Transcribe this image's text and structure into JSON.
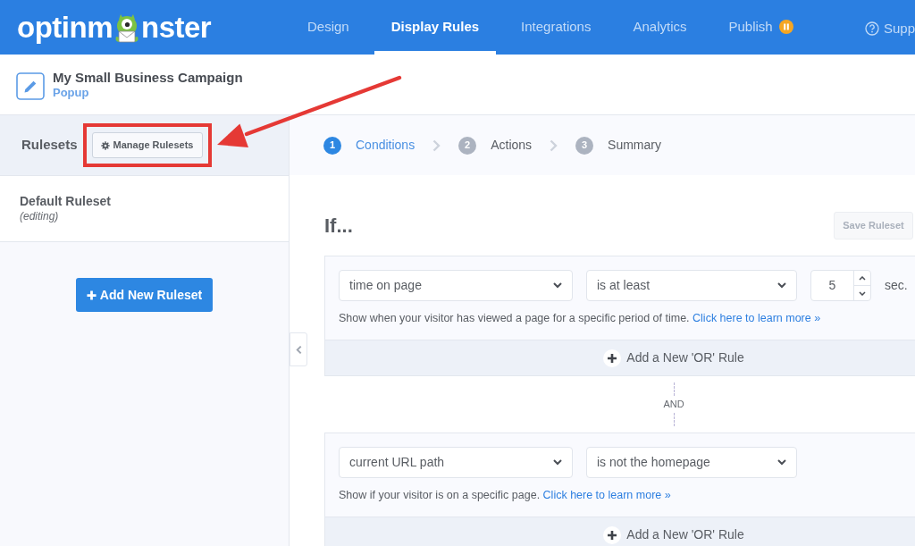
{
  "nav": {
    "logo": {
      "before": "optinm",
      "after": "nster"
    },
    "tabs": [
      {
        "label": "Design",
        "selected": false,
        "paused": false
      },
      {
        "label": "Display Rules",
        "selected": true,
        "paused": false
      },
      {
        "label": "Integrations",
        "selected": false,
        "paused": false
      },
      {
        "label": "Analytics",
        "selected": false,
        "paused": false
      },
      {
        "label": "Publish",
        "selected": false,
        "paused": true
      }
    ],
    "support": "Supp"
  },
  "campaign": {
    "title": "My Small Business Campaign",
    "type": "Popup"
  },
  "sidebar": {
    "title": "Rulesets",
    "manage_button": {
      "label": "Manage Rulesets",
      "highlighted": true
    },
    "rulesets": [
      {
        "name": "Default Ruleset",
        "status": "(editing)",
        "selected": true
      }
    ],
    "add_button": "Add New Ruleset"
  },
  "steps": [
    {
      "number": "1",
      "label": "Conditions",
      "selected": true
    },
    {
      "number": "2",
      "label": "Actions",
      "selected": false
    },
    {
      "number": "3",
      "label": "Summary",
      "selected": false
    }
  ],
  "heading": "If...",
  "save_button": {
    "label": "Save Ruleset",
    "disabled": true
  },
  "rule_groups": [
    {
      "rules": [
        {
          "condition": "time on page",
          "operator": "is at least",
          "value": "5",
          "unit": "sec.",
          "help": "Show when your visitor has viewed a page for a specific period of time.",
          "link": "Click here to learn more »"
        }
      ],
      "add_rule": "Add a New 'OR' Rule"
    },
    {
      "connector": "AND",
      "rules": [
        {
          "condition": "current URL path",
          "operator": "is not the homepage",
          "help": "Show if your visitor is on a specific page.",
          "link": "Click here to learn more »"
        }
      ],
      "add_rule": "Add a New 'OR' Rule"
    }
  ]
}
